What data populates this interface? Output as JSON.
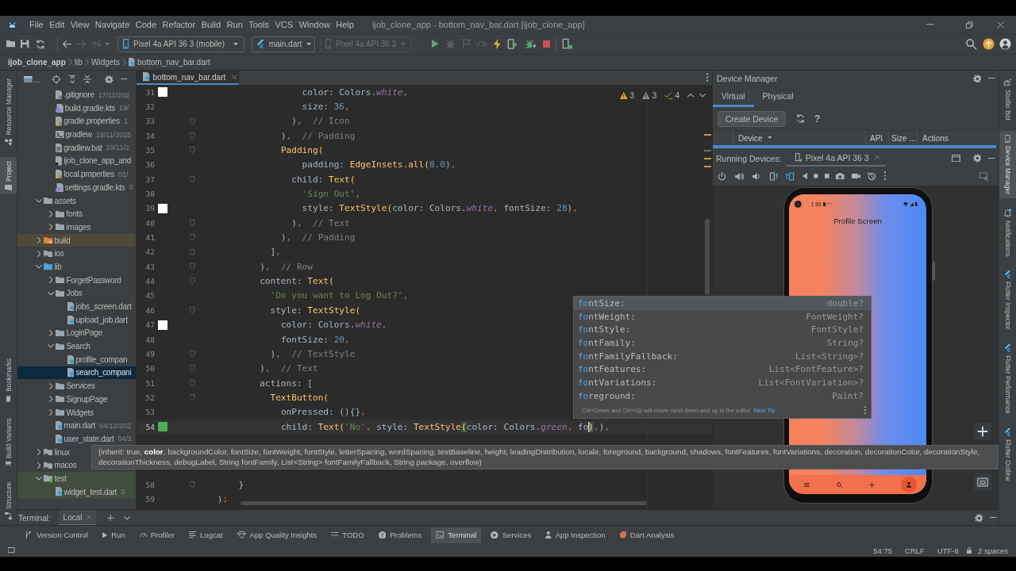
{
  "window": {
    "title": "ijob_clone_app - bottom_nav_bar.dart [ijob_clone_app]"
  },
  "menu": [
    "File",
    "Edit",
    "View",
    "Navigate",
    "Code",
    "Refactor",
    "Build",
    "Run",
    "Tools",
    "VCS",
    "Window",
    "Help"
  ],
  "toolbar": {
    "file_actions": [
      {
        "kind": "open",
        "disabled": false
      },
      {
        "kind": "save",
        "disabled": false
      },
      {
        "kind": "sync",
        "disabled": false
      }
    ],
    "navigation": [
      {
        "kind": "back",
        "disabled": false
      },
      {
        "kind": "forward",
        "disabled": true
      },
      {
        "kind": "vcs",
        "disabled": true
      }
    ],
    "device_selector": {
      "label": "Pixel 4a API 36 3 (mobile)",
      "disabled": false
    },
    "run_configuration": {
      "label": "main.dart",
      "disabled": false
    },
    "target_device": {
      "label": "Pixel 4a API 36 3",
      "disabled": true
    },
    "run_actions": [
      {
        "kind": "run",
        "disabled": false
      },
      {
        "kind": "debug",
        "disabled": true
      },
      {
        "kind": "profile",
        "disabled": true
      },
      {
        "kind": "gauge",
        "disabled": true
      },
      {
        "kind": "hot-reload",
        "disabled": false
      },
      {
        "kind": "apply-changes",
        "disabled": false
      },
      {
        "kind": "attach-debugger",
        "disabled": false
      },
      {
        "kind": "stop",
        "disabled": false
      }
    ],
    "device_actions": [
      {
        "kind": "mirror",
        "disabled": false
      }
    ]
  },
  "breadcrumb": [
    {
      "label": "ijob_clone_app",
      "kind": "project"
    },
    {
      "label": "lib",
      "kind": "folder"
    },
    {
      "label": "Widgets",
      "kind": "folder"
    },
    {
      "label": "bottom_nav_bar.dart",
      "kind": "dart-file"
    }
  ],
  "left_strip": {
    "top": [
      {
        "label": "Resource Manager",
        "kind": "resources",
        "selected": false
      },
      {
        "label": "Project",
        "kind": "project",
        "selected": true
      }
    ],
    "bottom": [
      {
        "label": "Bookmarks",
        "kind": "bookmarks",
        "selected": false
      },
      {
        "label": "Build Variants",
        "kind": "build-variants",
        "selected": false
      },
      {
        "label": "Structure",
        "kind": "structure",
        "selected": false
      }
    ]
  },
  "project": {
    "view_label": "…",
    "tree": [
      {
        "children": [
          {
            "label": ".gitignore",
            "date": "17/11/202",
            "kind": "ignore-file",
            "selected": false
          },
          {
            "label": "build.gradle.kts",
            "date": "19/",
            "kind": "gradle-file",
            "selected": false
          },
          {
            "label": "gradle.properties",
            "date": "1",
            "kind": "properties-file",
            "selected": false
          },
          {
            "label": "gradlew",
            "date": "19/11/2025",
            "kind": "shell-file",
            "selected": false
          },
          {
            "label": "gradlew.bat",
            "date": "19/11/2",
            "kind": "text-file",
            "selected": false
          },
          {
            "label": "ijob_clone_app_and",
            "kind": "module-file",
            "selected": false
          },
          {
            "label": "local.properties",
            "date": "01/",
            "kind": "properties-file",
            "selected": false
          },
          {
            "label": "settings.gradle.kts",
            "date": "3",
            "kind": "gradle-file",
            "selected": false
          }
        ]
      },
      {
        "label": "assets",
        "kind": "folder",
        "expanded": true,
        "selected": false,
        "children": [
          {
            "label": "fonts",
            "kind": "folder",
            "expanded": false,
            "selected": false
          },
          {
            "label": "images",
            "kind": "folder",
            "expanded": false,
            "selected": false
          }
        ]
      },
      {
        "label": "build",
        "kind": "excluded-folder",
        "expanded": false,
        "selected": false
      },
      {
        "label": "ios",
        "kind": "module-folder",
        "expanded": false,
        "selected": false
      },
      {
        "label": "lib",
        "kind": "source-folder",
        "expanded": true,
        "selected": false,
        "children": [
          {
            "label": "ForgetPassword",
            "kind": "folder",
            "expanded": false,
            "selected": false
          },
          {
            "label": "Jobs",
            "kind": "folder",
            "expanded": true,
            "selected": false,
            "children": [
              {
                "label": "jobs_screen.dart",
                "kind": "dart-file",
                "selected": false
              },
              {
                "label": "upload_job.dart",
                "kind": "dart-file",
                "selected": false
              }
            ]
          },
          {
            "label": "LoginPage",
            "kind": "folder",
            "expanded": false,
            "selected": false
          },
          {
            "label": "Search",
            "kind": "folder",
            "expanded": true,
            "selected": false,
            "children": [
              {
                "label": "profile_compan",
                "kind": "dart-file",
                "selected": false
              },
              {
                "label": "search_compani",
                "kind": "dart-file",
                "selected": true
              }
            ]
          },
          {
            "label": "Services",
            "kind": "folder",
            "expanded": false,
            "selected": false
          },
          {
            "label": "SignupPage",
            "kind": "folder",
            "expanded": false,
            "selected": false
          },
          {
            "label": "Widgets",
            "kind": "folder",
            "expanded": false,
            "selected": false
          },
          {
            "label": "main.dart",
            "date": "04/12/202",
            "kind": "dart-file",
            "selected": false
          },
          {
            "label": "user_state.dart",
            "date": "04/1",
            "kind": "dart-file",
            "selected": false
          }
        ]
      },
      {
        "label": "linux",
        "kind": "module-folder",
        "expanded": false,
        "selected": false
      },
      {
        "label": "macos",
        "kind": "module-folder",
        "expanded": false,
        "selected": false
      },
      {
        "label": "test",
        "kind": "test-folder",
        "expanded": true,
        "selected": false,
        "children": [
          {
            "label": "widget_test.dart",
            "date": "3",
            "kind": "dart-file",
            "selected": false
          }
        ]
      }
    ]
  },
  "editor": {
    "tabs": [
      {
        "label": "bottom_nav_bar.dart",
        "selected": true
      }
    ],
    "inspections": [
      {
        "kind": "warning",
        "count": "3"
      },
      {
        "kind": "weak-warning",
        "count": "3"
      },
      {
        "kind": "typo",
        "count": "4"
      }
    ],
    "lines": [
      {
        "number": "31",
        "color": "#ffffff",
        "fold": false,
        "current": false,
        "tokens": [
          {
            "kind": "plain",
            "text": "                    color: Colors."
          },
          {
            "kind": "constant",
            "text": "white"
          },
          {
            "kind": "punct",
            "text": ","
          }
        ]
      },
      {
        "number": "32",
        "fold": false,
        "current": false,
        "tokens": [
          {
            "kind": "plain",
            "text": "                    size: "
          },
          {
            "kind": "number",
            "text": "36"
          },
          {
            "kind": "punct",
            "text": ","
          }
        ]
      },
      {
        "number": "33",
        "fold": true,
        "current": false,
        "tokens": [
          {
            "kind": "plain",
            "text": "                  )"
          },
          {
            "kind": "punct",
            "text": ","
          },
          {
            "kind": "comment",
            "text": "  // Icon"
          }
        ]
      },
      {
        "number": "34",
        "fold": true,
        "current": false,
        "tokens": [
          {
            "kind": "plain",
            "text": "                )"
          },
          {
            "kind": "punct",
            "text": ","
          },
          {
            "kind": "comment",
            "text": "  // Padding"
          }
        ]
      },
      {
        "number": "35",
        "fold": true,
        "current": false,
        "tokens": [
          {
            "kind": "call",
            "text": "                Padding("
          }
        ]
      },
      {
        "number": "36",
        "fold": false,
        "current": false,
        "tokens": [
          {
            "kind": "plain",
            "text": "                    padding: "
          },
          {
            "kind": "call",
            "text": "EdgeInsets.all("
          },
          {
            "kind": "number",
            "text": "8.0"
          },
          {
            "kind": "plain",
            "text": ")"
          },
          {
            "kind": "punct",
            "text": ","
          }
        ]
      },
      {
        "number": "37",
        "fold": true,
        "current": false,
        "tokens": [
          {
            "kind": "plain",
            "text": "                  child: "
          },
          {
            "kind": "call",
            "text": "Text("
          }
        ]
      },
      {
        "number": "38",
        "fold": false,
        "current": false,
        "tokens": [
          {
            "kind": "string",
            "text": "                    'Sign Out'"
          },
          {
            "kind": "punct",
            "text": ","
          }
        ]
      },
      {
        "number": "39",
        "color": "#ffffff",
        "fold": false,
        "current": false,
        "tokens": [
          {
            "kind": "plain",
            "text": "                    style: "
          },
          {
            "kind": "call",
            "text": "TextStyle("
          },
          {
            "kind": "plain",
            "text": "color: Colors."
          },
          {
            "kind": "constant",
            "text": "white"
          },
          {
            "kind": "punct",
            "text": ", "
          },
          {
            "kind": "plain",
            "text": "fontSize: "
          },
          {
            "kind": "number",
            "text": "28"
          },
          {
            "kind": "plain",
            "text": ")"
          },
          {
            "kind": "punct",
            "text": ","
          }
        ]
      },
      {
        "number": "40",
        "fold": true,
        "current": false,
        "tokens": [
          {
            "kind": "plain",
            "text": "                  )"
          },
          {
            "kind": "punct",
            "text": ","
          },
          {
            "kind": "comment",
            "text": "  // Text"
          }
        ]
      },
      {
        "number": "41",
        "fold": true,
        "current": false,
        "tokens": [
          {
            "kind": "plain",
            "text": "                )"
          },
          {
            "kind": "punct",
            "text": ","
          },
          {
            "kind": "comment",
            "text": "  // Padding"
          }
        ]
      },
      {
        "number": "42",
        "fold": true,
        "current": false,
        "tokens": [
          {
            "kind": "plain",
            "text": "              ]"
          },
          {
            "kind": "punct",
            "text": ","
          }
        ]
      },
      {
        "number": "43",
        "fold": true,
        "current": false,
        "tokens": [
          {
            "kind": "plain",
            "text": "            )"
          },
          {
            "kind": "punct",
            "text": ","
          },
          {
            "kind": "comment",
            "text": "  // Row"
          }
        ]
      },
      {
        "number": "44",
        "fold": true,
        "current": false,
        "tokens": [
          {
            "kind": "plain",
            "text": "            content: "
          },
          {
            "kind": "call",
            "text": "Text("
          }
        ]
      },
      {
        "number": "45",
        "fold": false,
        "current": false,
        "tokens": [
          {
            "kind": "string",
            "text": "              'Do you want to Log Out?'"
          },
          {
            "kind": "punct",
            "text": ","
          }
        ]
      },
      {
        "number": "46",
        "fold": true,
        "current": false,
        "tokens": [
          {
            "kind": "plain",
            "text": "              style: "
          },
          {
            "kind": "call",
            "text": "TextStyle("
          }
        ]
      },
      {
        "number": "47",
        "color": "#ffffff",
        "fold": false,
        "current": false,
        "tokens": [
          {
            "kind": "plain",
            "text": "                color: Colors."
          },
          {
            "kind": "constant",
            "text": "white"
          },
          {
            "kind": "punct",
            "text": ","
          }
        ]
      },
      {
        "number": "48",
        "fold": false,
        "current": false,
        "tokens": [
          {
            "kind": "plain",
            "text": "                fontSize: "
          },
          {
            "kind": "number",
            "text": "20"
          },
          {
            "kind": "punct",
            "text": ","
          }
        ]
      },
      {
        "number": "49",
        "fold": true,
        "current": false,
        "tokens": [
          {
            "kind": "plain",
            "text": "              )"
          },
          {
            "kind": "punct",
            "text": ","
          },
          {
            "kind": "comment",
            "text": "  // TextStyle"
          }
        ]
      },
      {
        "number": "50",
        "fold": true,
        "current": false,
        "tokens": [
          {
            "kind": "plain",
            "text": "            )"
          },
          {
            "kind": "punct",
            "text": ","
          },
          {
            "kind": "comment",
            "text": "  // Text"
          }
        ]
      },
      {
        "number": "51",
        "fold": true,
        "current": false,
        "tokens": [
          {
            "kind": "plain",
            "text": "            actions: ["
          }
        ]
      },
      {
        "number": "52",
        "fold": true,
        "current": false,
        "tokens": [
          {
            "kind": "call",
            "text": "              TextButton("
          }
        ]
      },
      {
        "number": "53",
        "fold": false,
        "current": false,
        "tokens": [
          {
            "kind": "plain",
            "text": "                onPressed: (){}"
          },
          {
            "kind": "punct",
            "text": ","
          }
        ]
      },
      {
        "number": "54",
        "color": "#4caf50",
        "fold": false,
        "current": true,
        "tokens": [
          {
            "kind": "plain",
            "text": "                child: "
          },
          {
            "kind": "call",
            "text": "Text("
          },
          {
            "kind": "string",
            "text": "'No'"
          },
          {
            "kind": "punct",
            "text": ", "
          },
          {
            "kind": "plain",
            "text": "style: "
          },
          {
            "kind": "call",
            "text": "TextStyle"
          },
          {
            "kind": "match",
            "text": "("
          },
          {
            "kind": "plain",
            "text": "color: Colors."
          },
          {
            "kind": "constant",
            "text": "green"
          },
          {
            "kind": "punct",
            "text": ", "
          },
          {
            "kind": "plain",
            "text": "fo"
          },
          {
            "kind": "caret",
            "text": ")"
          },
          {
            "kind": "punct",
            "text": ","
          },
          {
            "kind": "plain",
            "text": ")"
          },
          {
            "kind": "punct",
            "text": ","
          }
        ]
      }
    ],
    "lines_below_tooltip": [
      {
        "number": "58",
        "fold": true,
        "current": false,
        "tokens": [
          {
            "kind": "plain",
            "text": "        }"
          }
        ]
      },
      {
        "number": "59",
        "fold": false,
        "current": false,
        "tokens": [
          {
            "kind": "plain",
            "text": "    )"
          },
          {
            "kind": "punct",
            "text": ";"
          }
        ]
      }
    ]
  },
  "completion_popup": {
    "items": [
      {
        "match": "fo",
        "rest": "ntSize:",
        "type": "double?",
        "selected": true
      },
      {
        "match": "fo",
        "rest": "ntWeight:",
        "type": "FontWeight?",
        "selected": false
      },
      {
        "match": "fo",
        "rest": "ntStyle:",
        "type": "FontStyle?",
        "selected": false
      },
      {
        "match": "fo",
        "rest": "ntFamily:",
        "type": "String?",
        "selected": false
      },
      {
        "match": "fo",
        "rest": "ntFamilyFallback:",
        "type": "List<String>?",
        "selected": false
      },
      {
        "match": "fo",
        "rest": "ntFeatures:",
        "type": "List<FontFeature>?",
        "selected": false
      },
      {
        "match": "fo",
        "rest": "ntVariations:",
        "type": "List<FontVariation>?",
        "selected": false
      },
      {
        "match": "fo",
        "rest": "reground:",
        "type": "Paint?",
        "selected": false
      }
    ],
    "hint": "Ctrl+Down and Ctrl+Up will move caret down and up in the editor",
    "hint_link": "Next Tip"
  },
  "parameter_tooltip": {
    "lines": [
      "{inherit: true, **color**, backgroundColor, fontSize, fontWeight, fontStyle, letterSpacing, wordSpacing, textBaseline, height, leadingDistribution, locale, foreground, background, shadows, fontFeatures, fontVariations, decoration, decorationColor, decorationStyle,",
      "decorationThickness, debugLabel, String fontFamily, List<String> fontFamilyFallback, String package, overflow)"
    ]
  },
  "device_manager": {
    "title": "Device Manager",
    "tabs": [
      {
        "label": "Virtual",
        "selected": true
      },
      {
        "label": "Physical",
        "selected": false
      }
    ],
    "create_button": "Create Device",
    "help_button": "?",
    "columns": [
      {
        "label": "Device",
        "sorted": true
      },
      {
        "label": "API",
        "sorted": false
      },
      {
        "label": "Size ...",
        "sorted": false
      },
      {
        "label": "Actions",
        "sorted": false
      }
    ]
  },
  "running_devices": {
    "label": "Running Devices:",
    "tabs": [
      {
        "label": "Pixel 4a API 36 3",
        "selected": true
      }
    ],
    "controls": [
      {
        "kind": "power"
      },
      {
        "kind": "volume-up"
      },
      {
        "kind": "volume-down"
      },
      {
        "kind": "rotate-left"
      },
      {
        "kind": "rotate-right"
      },
      {
        "kind": "back"
      },
      {
        "kind": "home"
      },
      {
        "kind": "overview"
      },
      {
        "kind": "screenshot"
      },
      {
        "kind": "record"
      },
      {
        "kind": "snapshot"
      },
      {
        "kind": "more"
      }
    ],
    "phone": {
      "time": "1:59",
      "title": "Profile Screen",
      "nav": [
        {
          "kind": "menu",
          "selected": false
        },
        {
          "kind": "search",
          "selected": false
        },
        {
          "kind": "add",
          "selected": false
        },
        {
          "kind": "profile",
          "selected": true
        }
      ]
    }
  },
  "right_strip": [
    {
      "label": "Studio Bot",
      "kind": "studio-bot",
      "selected": false
    },
    {
      "label": "Device Manager",
      "kind": "device-manager",
      "selected": true
    },
    {
      "label": "Notifications",
      "kind": "notifications",
      "selected": false
    },
    {
      "label": "Flutter Inspector",
      "kind": "flutter-inspector",
      "selected": false
    },
    {
      "label": "Flutter Performance",
      "kind": "flutter-performance",
      "selected": false
    },
    {
      "label": "Flutter Outline",
      "kind": "flutter-outline",
      "selected": false
    }
  ],
  "terminal": {
    "label": "Terminal:",
    "tabs": [
      {
        "label": "Local",
        "selected": true
      }
    ]
  },
  "tool_windows": [
    {
      "label": "Version Control",
      "kind": "vcs",
      "selected": false
    },
    {
      "label": "Run",
      "kind": "run",
      "selected": false
    },
    {
      "label": "Profiler",
      "kind": "profiler",
      "selected": false
    },
    {
      "label": "Logcat",
      "kind": "logcat",
      "selected": false
    },
    {
      "label": "App Quality Insights",
      "kind": "app-quality",
      "selected": false
    },
    {
      "label": "TODO",
      "kind": "todo",
      "selected": false
    },
    {
      "label": "Problems",
      "kind": "problems",
      "selected": false
    },
    {
      "label": "Terminal",
      "kind": "terminal",
      "selected": true
    },
    {
      "label": "Services",
      "kind": "services",
      "selected": false
    },
    {
      "label": "App Inspection",
      "kind": "app-inspection",
      "selected": false
    },
    {
      "label": "Dart Analysis",
      "kind": "dart-analysis",
      "selected": false
    }
  ],
  "status_bar": {
    "caret_position": "54:75",
    "line_separator": "CRLF",
    "encoding": "UTF-8",
    "indent": "2 spaces"
  }
}
